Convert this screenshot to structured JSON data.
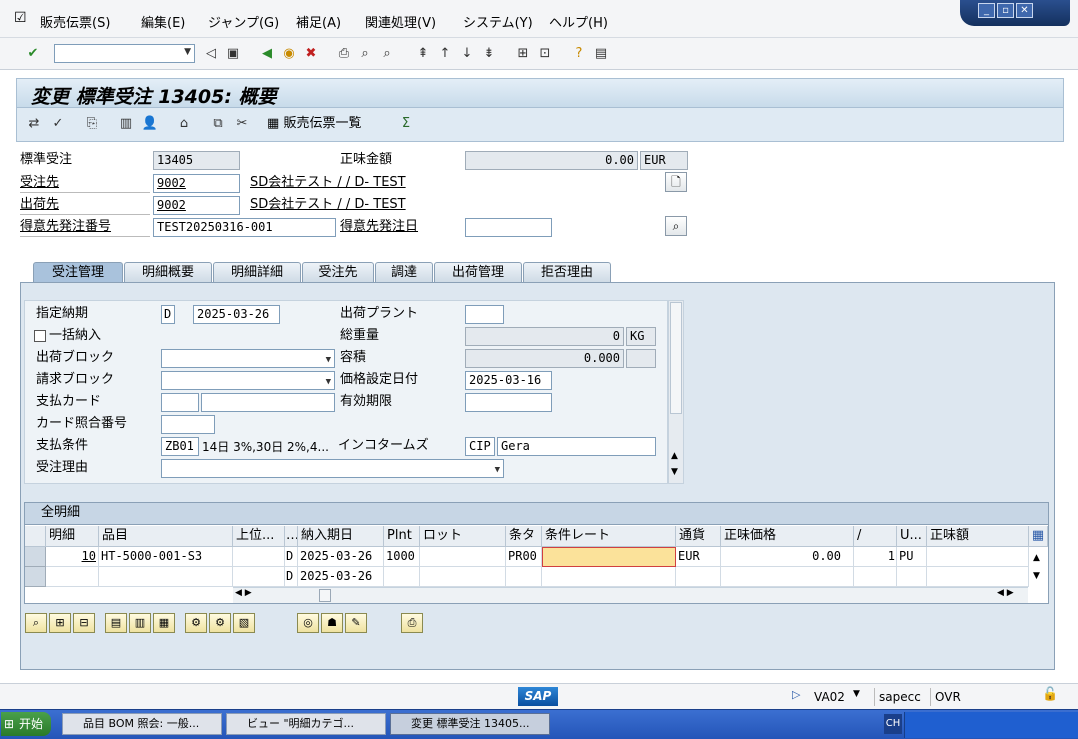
{
  "menu": {
    "items": [
      "販売伝票(S)",
      "編集(E)",
      "ジャンプ(G)",
      "補足(A)",
      "関連処理(V)",
      "システム(Y)",
      "ヘルプ(H)"
    ]
  },
  "window": {
    "title": "変更 標準受注 13405: 概要"
  },
  "apptoolbar": {
    "doc_list_label": "販売伝票一覧"
  },
  "header": {
    "order_type_label": "標準受注",
    "order_no": "13405",
    "net_value_label": "正味金額",
    "net_value": "0.00",
    "currency": "EUR",
    "sold_to_label": "受注先",
    "sold_to": "9002",
    "sold_to_name": "SD会社テスト / / D- TEST",
    "ship_to_label": "出荷先",
    "ship_to": "9002",
    "ship_to_name": "SD会社テスト / / D- TEST",
    "po_no_label": "得意先発注番号",
    "po_no": "TEST20250316-001",
    "po_date_label": "得意先発注日",
    "po_date": ""
  },
  "tabs": [
    "受注管理",
    "明細概要",
    "明細詳細",
    "受注先",
    "調達",
    "出荷管理",
    "拒否理由"
  ],
  "sales": {
    "req_deliv_date_label": "指定納期",
    "req_deliv_date_type": "D",
    "req_deliv_date": "2025-03-26",
    "deliv_plant_label": "出荷プラント",
    "deliv_plant": "",
    "complete_dlv_label": "一括納入",
    "total_weight_label": "総重量",
    "total_weight": "0",
    "weight_unit": "KG",
    "delivery_block_label": "出荷ブロック",
    "volume_label": "容積",
    "volume": "0.000",
    "billing_block_label": "請求ブロック",
    "pricing_date_label": "価格設定日付",
    "pricing_date": "2025-03-16",
    "payment_card_label": "支払カード",
    "valid_to_label": "有効期限",
    "card_verif_label": "カード照合番号",
    "payment_terms_label": "支払条件",
    "payment_terms": "ZB01",
    "payment_terms_text": "14日 3%,30日 2%,4...",
    "incoterms_label": "インコタームズ",
    "incoterms": "CIP",
    "incoterms2": "Gera",
    "order_reason_label": "受注理由"
  },
  "grid": {
    "title": "全明細",
    "columns": [
      "明細",
      "品目",
      "上位...",
      "…",
      "納入期日",
      "Plnt",
      "ロット",
      "条タ",
      "条件レート",
      "通貨",
      "正味価格",
      "/",
      "U...",
      "正味額"
    ],
    "rows": [
      [
        "10",
        "HT-5000-001-S3",
        "",
        "D",
        "2025-03-26",
        "1000",
        "",
        "PR00",
        "",
        "EUR",
        "0.00",
        "1",
        "PU",
        ""
      ],
      [
        "",
        "",
        "",
        "D",
        "2025-03-26",
        "",
        "",
        "",
        "",
        "",
        "",
        "",
        "",
        ""
      ]
    ]
  },
  "status": {
    "tcode": "VA02",
    "server": "sapecc",
    "mode": "OVR"
  },
  "taskbar": {
    "start": "开始",
    "tasks": [
      "品目 BOM 照会: 一般...",
      "ビュー \"明細カテゴ...",
      "変更 標準受注 13405..."
    ],
    "tray": "CH"
  }
}
